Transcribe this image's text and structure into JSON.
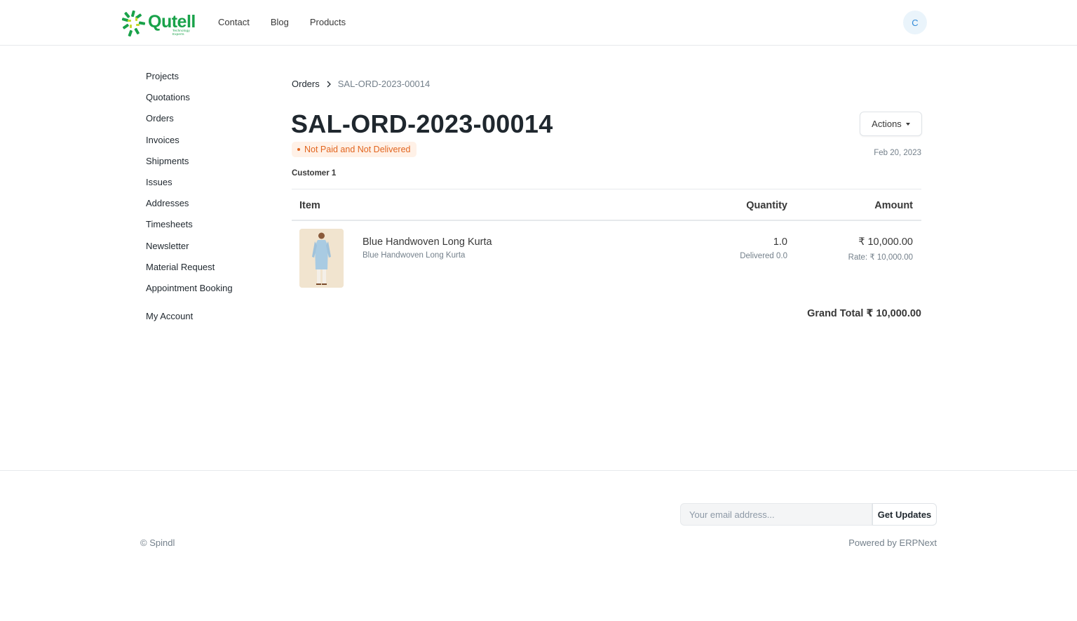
{
  "brand": {
    "name": "Qutell",
    "tagline": "Technology Experts",
    "color": "#19a24a"
  },
  "nav": {
    "links": [
      "Contact",
      "Blog",
      "Products"
    ],
    "avatar_initial": "C"
  },
  "sidebar": {
    "items": [
      "Projects",
      "Quotations",
      "Orders",
      "Invoices",
      "Shipments",
      "Issues",
      "Addresses",
      "Timesheets",
      "Newsletter",
      "Material Request",
      "Appointment Booking"
    ],
    "account": "My Account"
  },
  "breadcrumb": {
    "parent": "Orders",
    "current": "SAL-ORD-2023-00014"
  },
  "order": {
    "title": "SAL-ORD-2023-00014",
    "status": "Not Paid and Not Delivered",
    "status_color": "#e2651f",
    "customer": "Customer 1",
    "date": "Feb 20, 2023",
    "actions_label": "Actions"
  },
  "table": {
    "headers": {
      "item": "Item",
      "quantity": "Quantity",
      "amount": "Amount"
    },
    "rows": [
      {
        "name": "Blue Handwoven Long Kurta",
        "description": "Blue Handwoven Long Kurta",
        "quantity": "1.0",
        "delivered": "Delivered 0.0",
        "amount": "₹ 10,000.00",
        "rate": "Rate: ₹ 10,000.00"
      }
    ]
  },
  "totals": {
    "label": "Grand Total",
    "value": "₹ 10,000.00"
  },
  "footer": {
    "email_placeholder": "Your email address...",
    "subscribe_label": "Get Updates",
    "copyright": "© Spindl",
    "powered_by": "Powered by ERPNext"
  }
}
